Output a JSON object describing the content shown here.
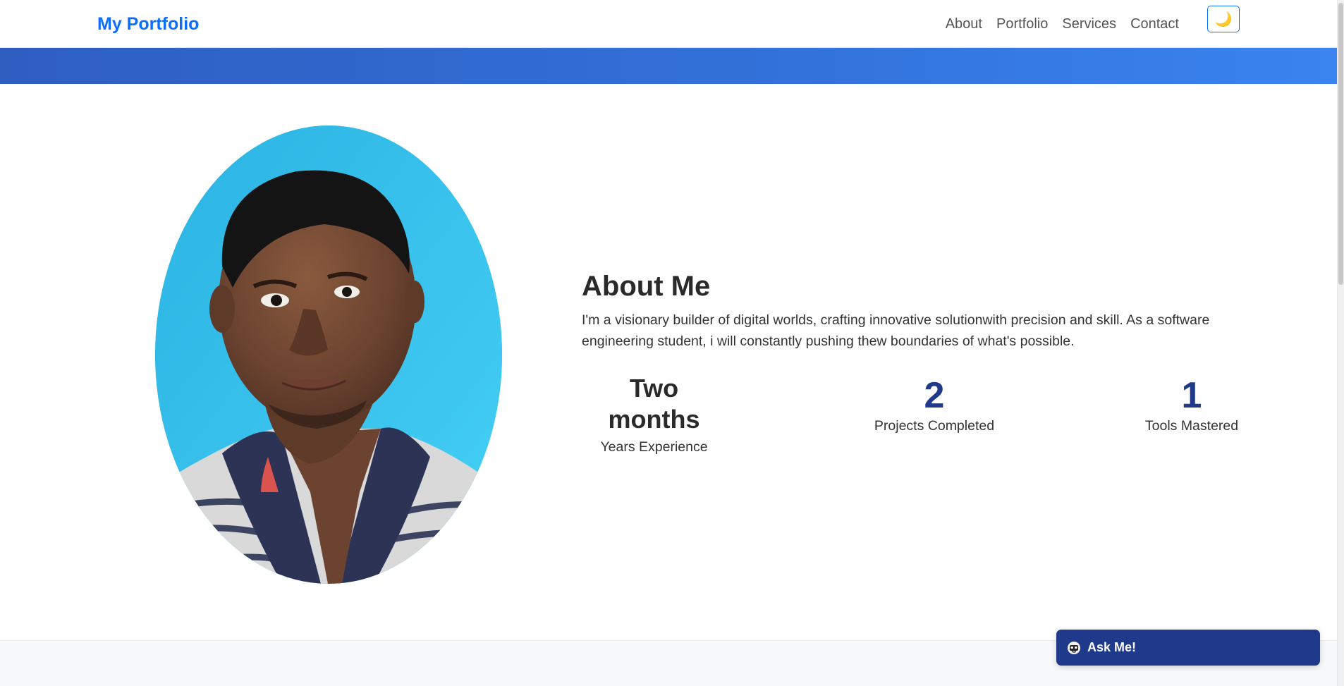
{
  "navbar": {
    "brand": "My Portfolio",
    "links": [
      "About",
      "Portfolio",
      "Services",
      "Contact"
    ],
    "theme_toggle_icon": "moon-icon",
    "theme_toggle_glyph": "🌙"
  },
  "colors": {
    "brand": "#0d6efd",
    "banner_start": "#2f5ec1",
    "banner_end": "#3a84f0",
    "stat_number": "#1f3a8a",
    "chat_widget": "#1f3a8a"
  },
  "about": {
    "title": "About Me",
    "text": "I'm a visionary builder of digital worlds, crafting innovative solutionwith precision and skill. As a software engineering student, i will constantly pushing thew boundaries of what's possible.",
    "stats": [
      {
        "value": "Two months",
        "label": "Years Experience"
      },
      {
        "value": "2",
        "label": "Projects Completed"
      },
      {
        "value": "1",
        "label": "Tools Mastered"
      }
    ]
  },
  "chat_widget": {
    "label": "Ask Me!",
    "icon": "bot-icon"
  }
}
